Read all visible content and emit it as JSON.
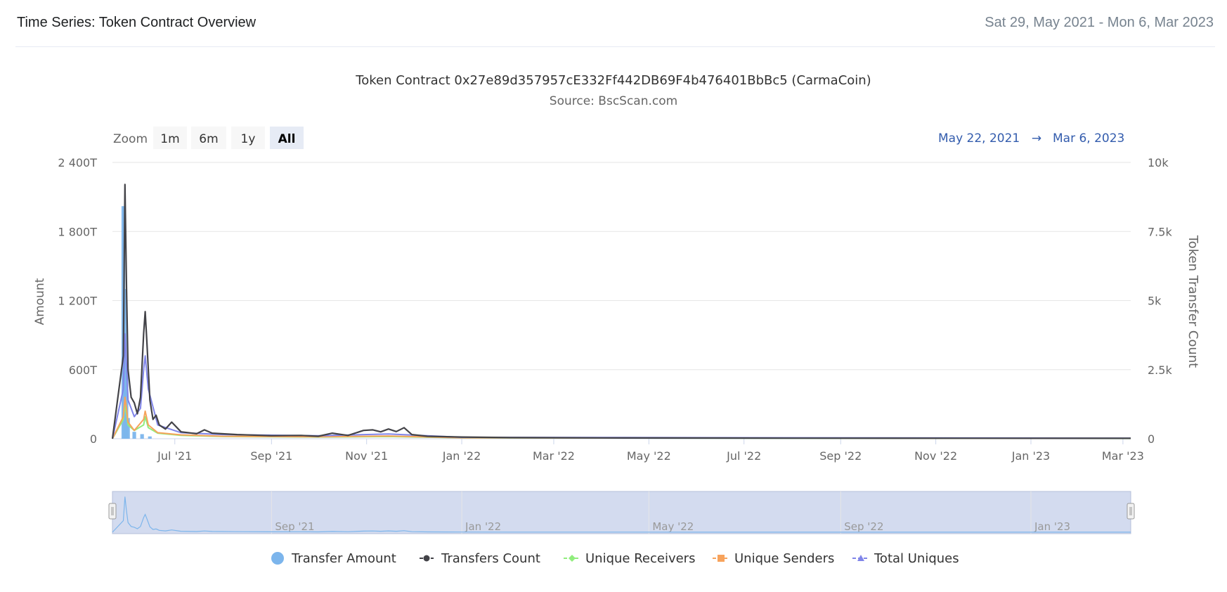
{
  "header": {
    "title": "Time Series: Token Contract Overview",
    "date_range": "Sat 29, May 2021 - Mon 6, Mar 2023"
  },
  "range_selector": {
    "zoom_label": "Zoom",
    "buttons": [
      "1m",
      "6m",
      "1y",
      "All"
    ],
    "selected": "All",
    "from": "May 22, 2021",
    "arrow": "→",
    "to": "Mar 6, 2023"
  },
  "navigator": {
    "labels": [
      "Sep '21",
      "Jan '22",
      "May '22",
      "Sep '22",
      "Jan '23"
    ]
  },
  "chart_data": {
    "type": "line",
    "title": "Token Contract 0x27e89d357957cE332Ff442DB69F4b476401BbBc5 (CarmaCoin)",
    "subtitle": "Source: BscScan.com",
    "x_range": [
      "2021-05-22",
      "2023-03-06"
    ],
    "x_ticks": [
      "Jul '21",
      "Sep '21",
      "Nov '21",
      "Jan '22",
      "Mar '22",
      "May '22",
      "Jul '22",
      "Sep '22",
      "Nov '22",
      "Jan '23",
      "Mar '23"
    ],
    "y_left": {
      "label": "Amount",
      "ticks": [
        "0",
        "600T",
        "1 200T",
        "1 800T",
        "2 400T"
      ],
      "range": [
        0,
        2400
      ]
    },
    "y_right": {
      "label": "Token Transfer Count",
      "ticks": [
        "0",
        "2.5k",
        "5k",
        "7.5k",
        "10k"
      ],
      "range": [
        0,
        10000
      ]
    },
    "grid": true,
    "legend_position": "bottom",
    "colors": {
      "transfer_amount": "#7cb5ec",
      "transfers_count": "#434348",
      "unique_receivers": "#90ed7d",
      "unique_senders": "#f7a35c",
      "total_uniques": "#8085e9"
    },
    "series": [
      {
        "name": "Transfer Amount",
        "axis": "left",
        "kind": "column",
        "points": [
          [
            "2021-05-29",
            2020
          ],
          [
            "2021-05-30",
            1300
          ],
          [
            "2021-05-31",
            600
          ],
          [
            "2021-06-01",
            180
          ],
          [
            "2021-06-05",
            60
          ],
          [
            "2021-06-10",
            40
          ],
          [
            "2021-06-15",
            20
          ]
        ]
      },
      {
        "name": "Transfers Count",
        "axis": "right",
        "kind": "line",
        "points": [
          [
            "2021-05-22",
            0
          ],
          [
            "2021-05-29",
            3000
          ],
          [
            "2021-05-30",
            9200
          ],
          [
            "2021-05-31",
            5500
          ],
          [
            "2021-06-01",
            2500
          ],
          [
            "2021-06-03",
            1500
          ],
          [
            "2021-06-05",
            1300
          ],
          [
            "2021-06-07",
            900
          ],
          [
            "2021-06-09",
            1500
          ],
          [
            "2021-06-11",
            3800
          ],
          [
            "2021-06-12",
            4600
          ],
          [
            "2021-06-13",
            3600
          ],
          [
            "2021-06-15",
            1400
          ],
          [
            "2021-06-17",
            700
          ],
          [
            "2021-06-19",
            850
          ],
          [
            "2021-06-21",
            500
          ],
          [
            "2021-06-25",
            350
          ],
          [
            "2021-06-29",
            600
          ],
          [
            "2021-07-05",
            250
          ],
          [
            "2021-07-15",
            180
          ],
          [
            "2021-07-20",
            320
          ],
          [
            "2021-07-25",
            200
          ],
          [
            "2021-08-10",
            150
          ],
          [
            "2021-09-01",
            110
          ],
          [
            "2021-09-20",
            120
          ],
          [
            "2021-10-01",
            90
          ],
          [
            "2021-10-10",
            200
          ],
          [
            "2021-10-20",
            120
          ],
          [
            "2021-10-30",
            300
          ],
          [
            "2021-11-05",
            320
          ],
          [
            "2021-11-10",
            250
          ],
          [
            "2021-11-15",
            350
          ],
          [
            "2021-11-20",
            260
          ],
          [
            "2021-11-25",
            400
          ],
          [
            "2021-11-30",
            150
          ],
          [
            "2021-12-10",
            90
          ],
          [
            "2022-01-01",
            60
          ],
          [
            "2022-02-01",
            40
          ],
          [
            "2022-04-01",
            30
          ],
          [
            "2022-08-01",
            20
          ],
          [
            "2023-03-06",
            15
          ]
        ]
      },
      {
        "name": "Unique Receivers",
        "axis": "right",
        "kind": "line",
        "points": [
          [
            "2021-05-22",
            0
          ],
          [
            "2021-05-29",
            700
          ],
          [
            "2021-05-30",
            1200
          ],
          [
            "2021-05-31",
            900
          ],
          [
            "2021-06-01",
            500
          ],
          [
            "2021-06-05",
            300
          ],
          [
            "2021-06-11",
            500
          ],
          [
            "2021-06-12",
            800
          ],
          [
            "2021-06-14",
            400
          ],
          [
            "2021-06-20",
            200
          ],
          [
            "2021-07-05",
            120
          ],
          [
            "2021-08-01",
            80
          ],
          [
            "2021-10-01",
            60
          ],
          [
            "2021-11-15",
            80
          ],
          [
            "2022-01-01",
            30
          ],
          [
            "2023-03-06",
            10
          ]
        ]
      },
      {
        "name": "Unique Senders",
        "axis": "right",
        "kind": "line",
        "points": [
          [
            "2021-05-22",
            0
          ],
          [
            "2021-05-29",
            800
          ],
          [
            "2021-05-30",
            1500
          ],
          [
            "2021-05-31",
            1100
          ],
          [
            "2021-06-01",
            600
          ],
          [
            "2021-06-05",
            300
          ],
          [
            "2021-06-11",
            700
          ],
          [
            "2021-06-12",
            1000
          ],
          [
            "2021-06-14",
            500
          ],
          [
            "2021-06-20",
            220
          ],
          [
            "2021-07-05",
            140
          ],
          [
            "2021-08-01",
            90
          ],
          [
            "2021-10-01",
            70
          ],
          [
            "2021-11-15",
            100
          ],
          [
            "2022-01-01",
            35
          ],
          [
            "2023-03-06",
            12
          ]
        ]
      },
      {
        "name": "Total Uniques",
        "axis": "right",
        "kind": "line",
        "points": [
          [
            "2021-05-22",
            0
          ],
          [
            "2021-05-29",
            1800
          ],
          [
            "2021-05-30",
            3800
          ],
          [
            "2021-05-31",
            2700
          ],
          [
            "2021-06-01",
            1400
          ],
          [
            "2021-06-05",
            800
          ],
          [
            "2021-06-09",
            1100
          ],
          [
            "2021-06-11",
            2500
          ],
          [
            "2021-06-12",
            3000
          ],
          [
            "2021-06-14",
            1800
          ],
          [
            "2021-06-20",
            500
          ],
          [
            "2021-07-05",
            220
          ],
          [
            "2021-08-01",
            150
          ],
          [
            "2021-10-01",
            110
          ],
          [
            "2021-11-15",
            170
          ],
          [
            "2022-01-01",
            50
          ],
          [
            "2023-03-06",
            20
          ]
        ]
      }
    ]
  }
}
